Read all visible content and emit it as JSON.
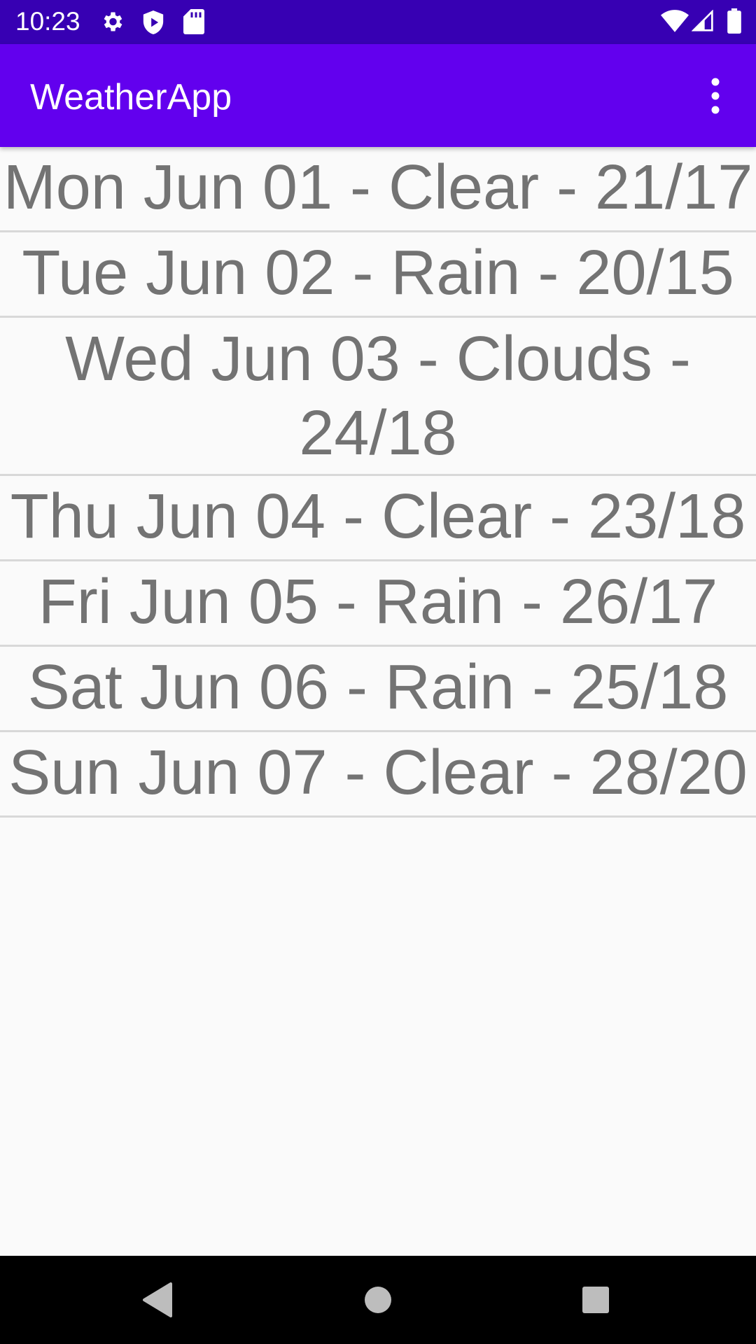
{
  "status_bar": {
    "time": "10:23",
    "icons": [
      "gear-icon",
      "shield-icon",
      "sd-card-icon",
      "wifi-icon",
      "signal-icon",
      "battery-icon"
    ]
  },
  "app_bar": {
    "title": "WeatherApp",
    "overflow_icon": "more-vert-icon"
  },
  "forecast": [
    {
      "label": "Mon Jun 01 - Clear - 21/17"
    },
    {
      "label": "Tue Jun 02 - Rain - 20/15"
    },
    {
      "label": "Wed Jun 03 - Clouds - 24/18"
    },
    {
      "label": "Thu Jun 04 - Clear - 23/18"
    },
    {
      "label": "Fri Jun 05 - Rain - 26/17"
    },
    {
      "label": "Sat Jun 06 - Rain - 25/18"
    },
    {
      "label": "Sun Jun 07 - Clear - 28/20"
    }
  ],
  "nav_bar": {
    "buttons": [
      "back-icon",
      "home-icon",
      "recents-icon"
    ]
  },
  "colors": {
    "status_bar": "#3700b3",
    "app_bar": "#6200ee",
    "background": "#fafafa",
    "item_text": "#737373",
    "divider": "#d8d8d8"
  }
}
